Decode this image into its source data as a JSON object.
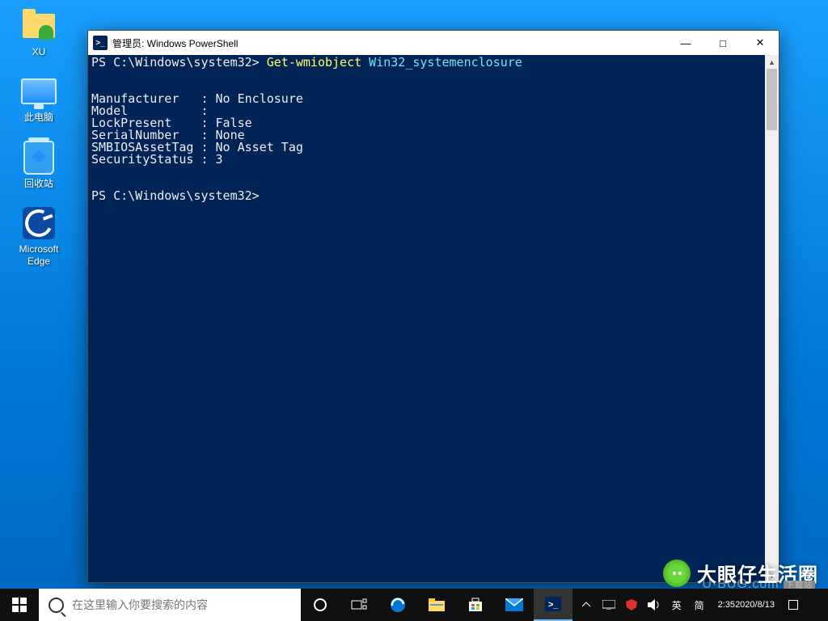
{
  "desktop": {
    "icons": [
      {
        "id": "xu",
        "label": "XU"
      },
      {
        "id": "this-pc",
        "label": "此电脑"
      },
      {
        "id": "recycle",
        "label": "回收站"
      },
      {
        "id": "edge",
        "label": "Microsoft\nEdge"
      }
    ]
  },
  "window": {
    "title": "管理员: Windows PowerShell",
    "prompt1_prefix": "PS C:\\Windows\\system32> ",
    "command_part1": "Get-wmiobject",
    "command_part2": " Win32_systemenclosure",
    "output_lines": [
      "Manufacturer   : No Enclosure",
      "Model          :",
      "LockPresent    : False",
      "SerialNumber   : None",
      "SMBIOSAssetTag : No Asset Tag",
      "SecurityStatus : 3"
    ],
    "prompt2": "PS C:\\Windows\\system32>",
    "buttons": {
      "min": "—",
      "max": "□",
      "close": "✕"
    }
  },
  "watermark": {
    "text": "大眼仔生活圈",
    "site": "U·BUG.com",
    "tag": "下载站"
  },
  "taskbar": {
    "search_placeholder": "在这里输入你要搜索的内容",
    "tray": {
      "ime1": "英",
      "ime2": "简",
      "time": "2:35",
      "date": "2020/8/13"
    }
  }
}
